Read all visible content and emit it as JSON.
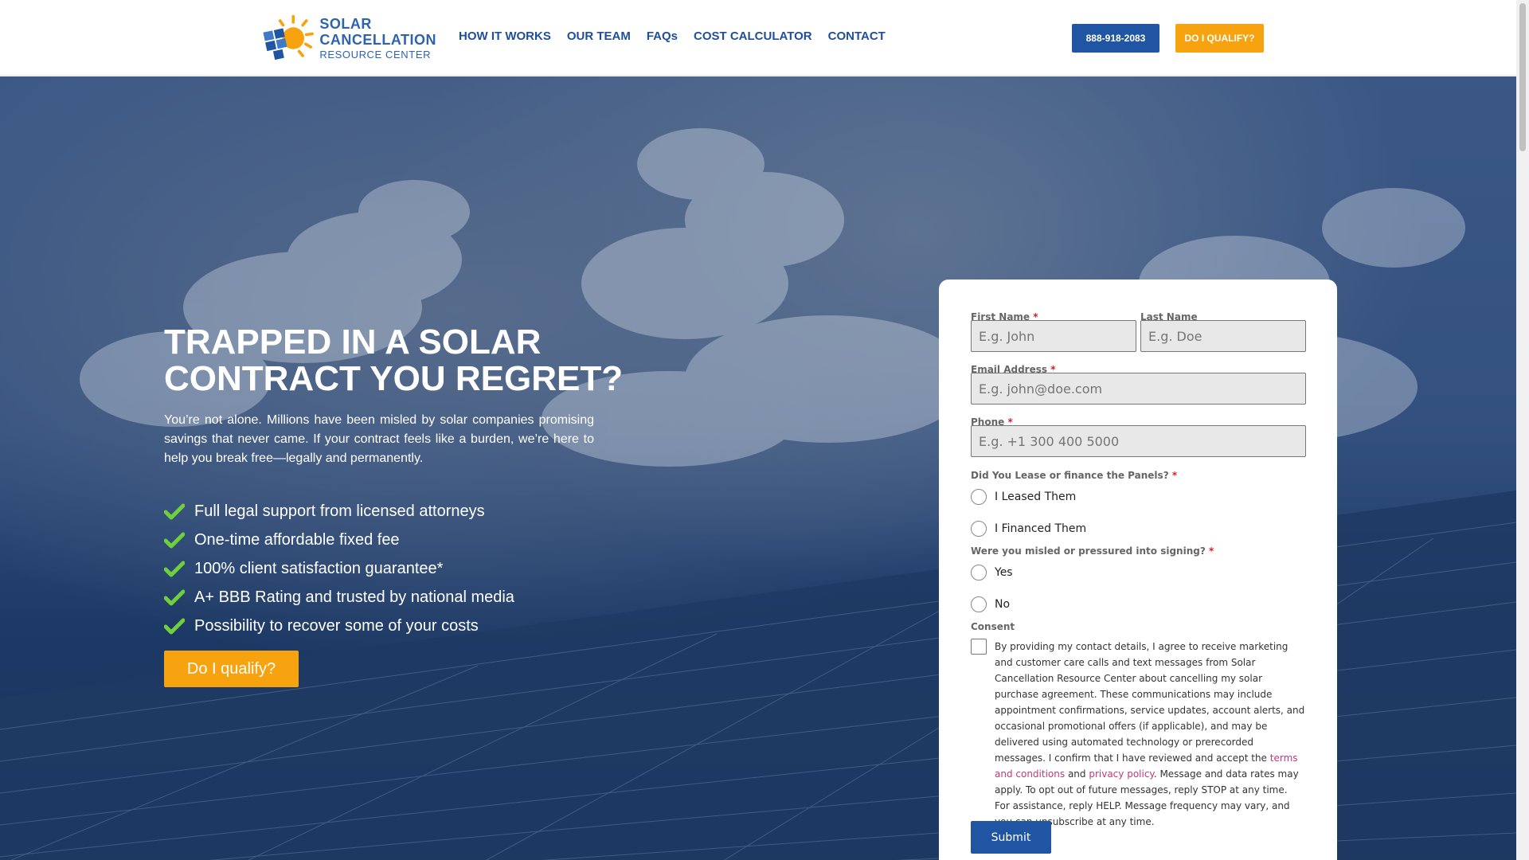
{
  "header": {
    "logo": {
      "line1": "SOLAR",
      "line2": "CANCELLATION",
      "line3": "RESOURCE CENTER"
    },
    "nav": [
      "HOW IT WORKS",
      "OUR TEAM",
      "FAQs",
      "COST CALCULATOR",
      "CONTACT"
    ],
    "phone_label": "888-918-2083",
    "qualify_label": "DO I QUALIFY?"
  },
  "hero": {
    "title_line1": "TRAPPED IN A SOLAR",
    "title_line2": "CONTRACT YOU REGRET?",
    "text": "You’re not alone. Millions have been misled by solar companies promising savings that never came. If your contract feels like a burden, we’re here to help you break free—legally and permanently.",
    "features": [
      "Full legal support from licensed attorneys",
      "One-time affordable fixed fee",
      "100% client satisfaction guarantee*",
      "A+ BBB Rating and trusted by national media",
      "Possibility to recover some of your costs"
    ],
    "cta_label": "Do I qualify?"
  },
  "form": {
    "first_name": {
      "label": "First Name",
      "placeholder": "E.g. John",
      "required": "*"
    },
    "last_name": {
      "label": "Last Name",
      "placeholder": "E.g. Doe"
    },
    "email": {
      "label": "Email Address",
      "placeholder": "E.g. john@doe.com",
      "required": "*"
    },
    "phone": {
      "label": "Phone",
      "placeholder": "E.g. +1 300 400 5000",
      "required": "*"
    },
    "lease_question": {
      "label": "Did You Lease or finance the Panels?",
      "required": "*",
      "options": [
        "I Leased Them",
        "I Financed Them"
      ]
    },
    "misled_question": {
      "label": "Were you misled or pressured into signing?",
      "required": "*",
      "options": [
        "Yes",
        "No"
      ]
    },
    "consent": {
      "label": "Consent",
      "text_before": "By providing my contact details, I agree to receive marketing and customer care calls and text messages from Solar Cancellation Resource Center about cancelling my solar purchase agreement. These communications may include appointment confirmations, service updates, account alerts, and occasional promotional offers (if applicable), and may be delivered using automated technology or prerecorded messages. I confirm that I have reviewed and accept the ",
      "terms_link": "terms and conditions",
      "and_text": " and ",
      "privacy_link": "privacy policy",
      "text_after": ". Message and data rates may apply. To opt out of future messages, reply STOP at any time. For assistance, reply HELP. Message frequency may vary, and you can unsubscribe at any time."
    },
    "submit_label": "Submit"
  },
  "colors": {
    "brand_blue": "#1f55a3",
    "accent_orange": "#f6a30f",
    "check_green": "#6fcf3c",
    "link_pink": "#c0397a"
  }
}
